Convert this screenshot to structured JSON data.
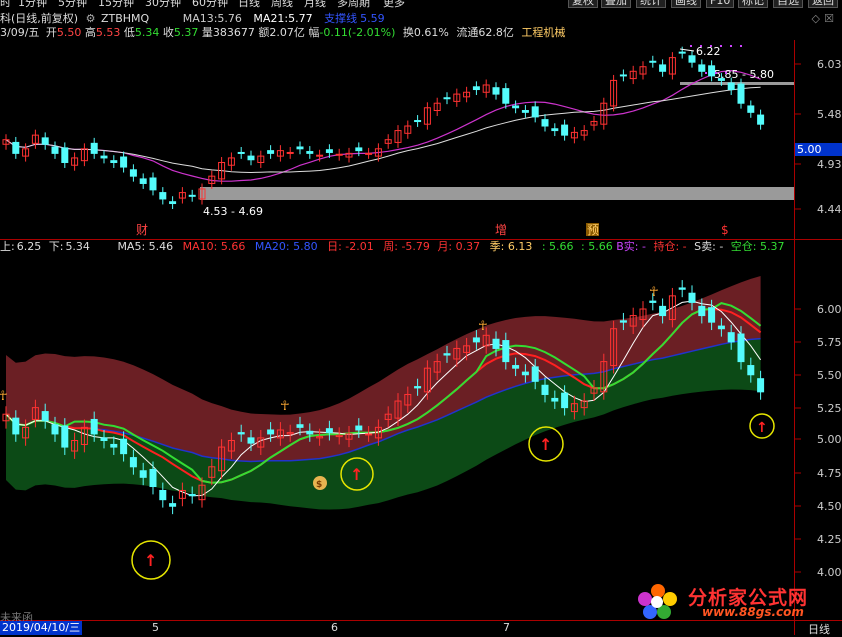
{
  "topbar": {
    "left_items": [
      "时",
      "1分钟",
      "5分钟",
      "15分钟",
      "30分钟",
      "60分钟",
      "日线",
      "周线",
      "月线",
      "多周期",
      "更多"
    ],
    "right_buttons": [
      "复权",
      "叠加",
      "统计",
      "画线",
      "F10",
      "标记",
      "自选",
      "返回"
    ]
  },
  "header": {
    "name_prefix": "科(日线,前复权)",
    "code_icon": "gear-icon",
    "code": "ZTBHMQ",
    "ma13_label": "MA13:",
    "ma13_value": "5.76",
    "ma21_label": "MA21:",
    "ma21_value": "5.77",
    "extra_label": "支撑线",
    "extra_value": "5.59"
  },
  "quote": {
    "date": "3/09/五",
    "open_label": "开",
    "open": "5.50",
    "high_label": "高",
    "high": "5.53",
    "low_label": "低",
    "low": "5.34",
    "close_label": "收",
    "close": "5.37",
    "vol_label": "量",
    "vol": "383677",
    "amt_label": "额",
    "amt": "2.07亿",
    "chg_label": "幅",
    "chg": "-0.11(-2.01%)",
    "turn_label": "换",
    "turn": "0.61%",
    "float_label": "流通",
    "float": "62.8亿",
    "sector": "工程机械"
  },
  "main_chart": {
    "y_ticks": [
      "6.03",
      "5.48",
      "4.93",
      "4.44"
    ],
    "price_box": "5.00",
    "high_annot": "6.22",
    "range_annot": "5.85 - 5.80",
    "low_annot": "4.53 - 4.69",
    "markers": [
      "财",
      "增",
      "预",
      "$"
    ]
  },
  "indicator": {
    "up_label": "上:",
    "up": "6.25",
    "down_label": "下:",
    "down": "5.34",
    "ma5": "MA5: 5.46",
    "ma10": "MA10: 5.66",
    "ma20": "MA20: 5.80",
    "day": "日: -2.01",
    "week": "周: -5.79",
    "month": "月: 0.37",
    "season": "季: 6.13",
    "v1": ": 5.66",
    "v2": ": 5.66",
    "b": "B实: -",
    "hold": "持仓: -",
    "s": "S卖: -",
    "empty": "空仓: 5.37",
    "y_ticks": [
      "6.00",
      "5.75",
      "5.50",
      "5.25",
      "5.00",
      "4.75",
      "4.50",
      "4.25",
      "4.00"
    ]
  },
  "bottom": {
    "cursor_label": "未来函",
    "date": "2019/04/10/三",
    "month_ticks": [
      "5",
      "6",
      "7"
    ],
    "right_tab": "日线"
  },
  "watermark": {
    "cn": "分析家公式网",
    "url": "www.88gs.com"
  },
  "colors": {
    "up": "#ff3232",
    "down": "#54fcfc",
    "ma_white": "#ffffff",
    "ma_magenta": "#cc33cc",
    "band_upper": "#6b1f24",
    "band_lower": "#0c4a16",
    "line_red": "#ff2020",
    "line_green": "#33dd33",
    "line_blue": "#2233cc",
    "price_box": "#0033cc"
  }
}
